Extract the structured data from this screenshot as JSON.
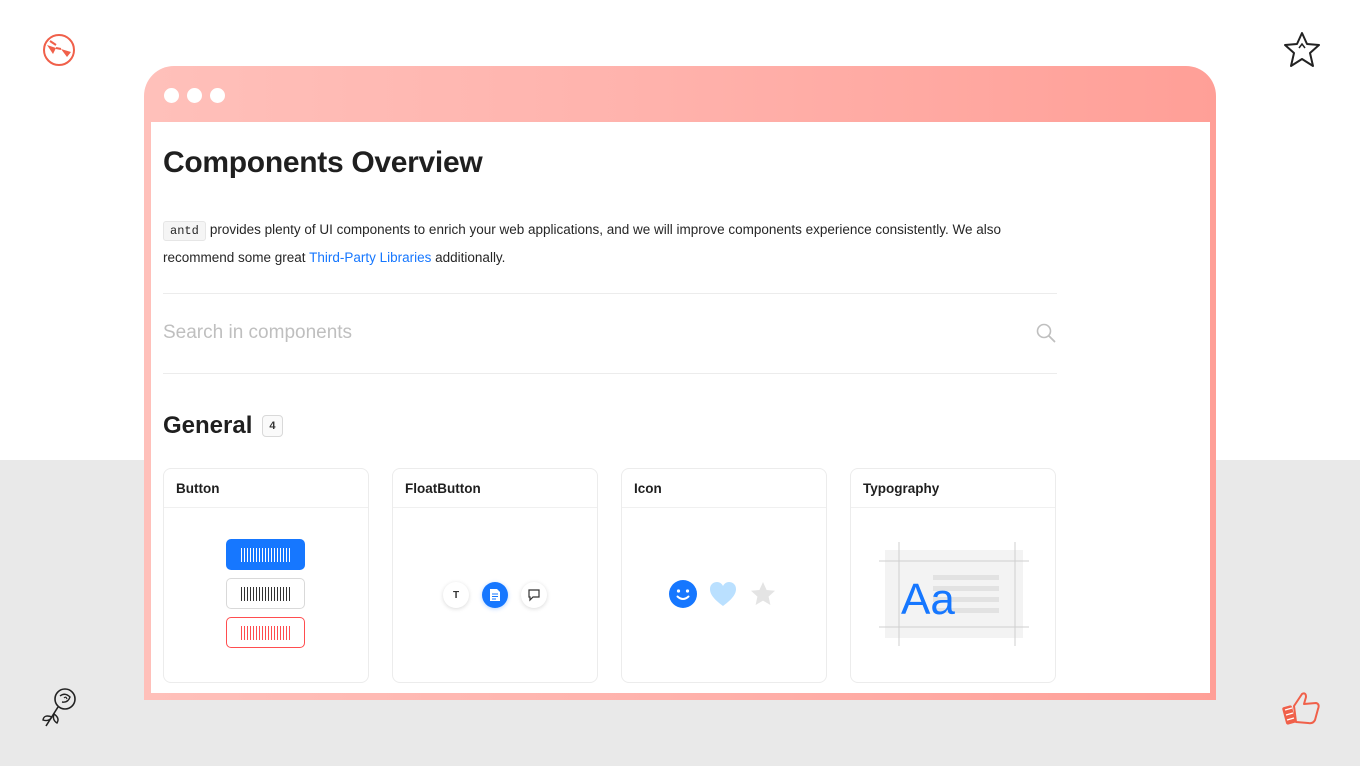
{
  "page": {
    "title": "Components Overview",
    "intro": {
      "code": "antd",
      "text_before_link": "provides plenty of UI components to enrich your web applications, and we will improve components experience consistently. We also recommend some great",
      "link_text": "Third-Party Libraries",
      "text_after_link": "additionally."
    }
  },
  "search": {
    "placeholder": "Search in components",
    "value": ""
  },
  "section": {
    "title": "General",
    "count": "4"
  },
  "cards": [
    {
      "title": "Button"
    },
    {
      "title": "FloatButton"
    },
    {
      "title": "Icon"
    },
    {
      "title": "Typography"
    }
  ],
  "typography_preview": {
    "sample": "Aa"
  },
  "float_preview": {
    "letter": "T"
  },
  "colors": {
    "primary": "#1677ff",
    "danger": "#ff4d4f",
    "frame_gradient_start": "#ffc0ba",
    "frame_gradient_end": "#ff9f97",
    "decoration_accent": "#f0604a"
  },
  "icons": {
    "decorations": [
      "glasses-face-icon",
      "star-icon",
      "rose-icon",
      "thumbs-up-icon"
    ],
    "icon_card": [
      "smile-icon",
      "heart-icon",
      "star-icon"
    ],
    "float_card": [
      "text-icon",
      "file-icon",
      "chat-icon"
    ]
  }
}
